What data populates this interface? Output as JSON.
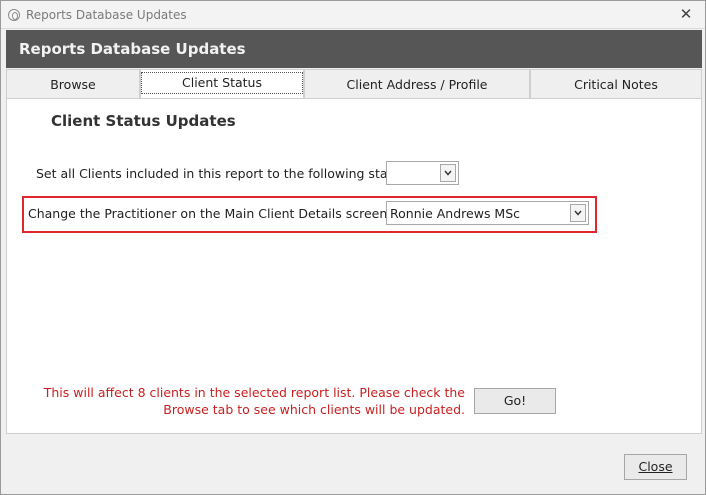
{
  "window": {
    "title": "Reports Database Updates",
    "close_glyph": "✕"
  },
  "header": {
    "title": "Reports Database Updates"
  },
  "tabs": [
    {
      "label": "Browse",
      "active": false
    },
    {
      "label": "Client Status",
      "active": true
    },
    {
      "label": "Client Address / Profile",
      "active": false
    },
    {
      "label": "Critical Notes",
      "active": false
    }
  ],
  "panel": {
    "section_title": "Client Status Updates",
    "status_label": "Set all Clients included in this report to the following status",
    "status_value": "",
    "practitioner_label": "Change the Practitioner on the Main Client Details screen to:",
    "practitioner_value": "Ronnie Andrews MSc",
    "warning_text": "This will affect 8 clients in the selected report list. Please check the Browse tab to see which clients will be updated.",
    "go_label": "Go!"
  },
  "footer": {
    "close_label": "Close"
  },
  "colors": {
    "header_bg": "#565656",
    "highlight": "#e0262f",
    "warning": "#c81f1f"
  }
}
